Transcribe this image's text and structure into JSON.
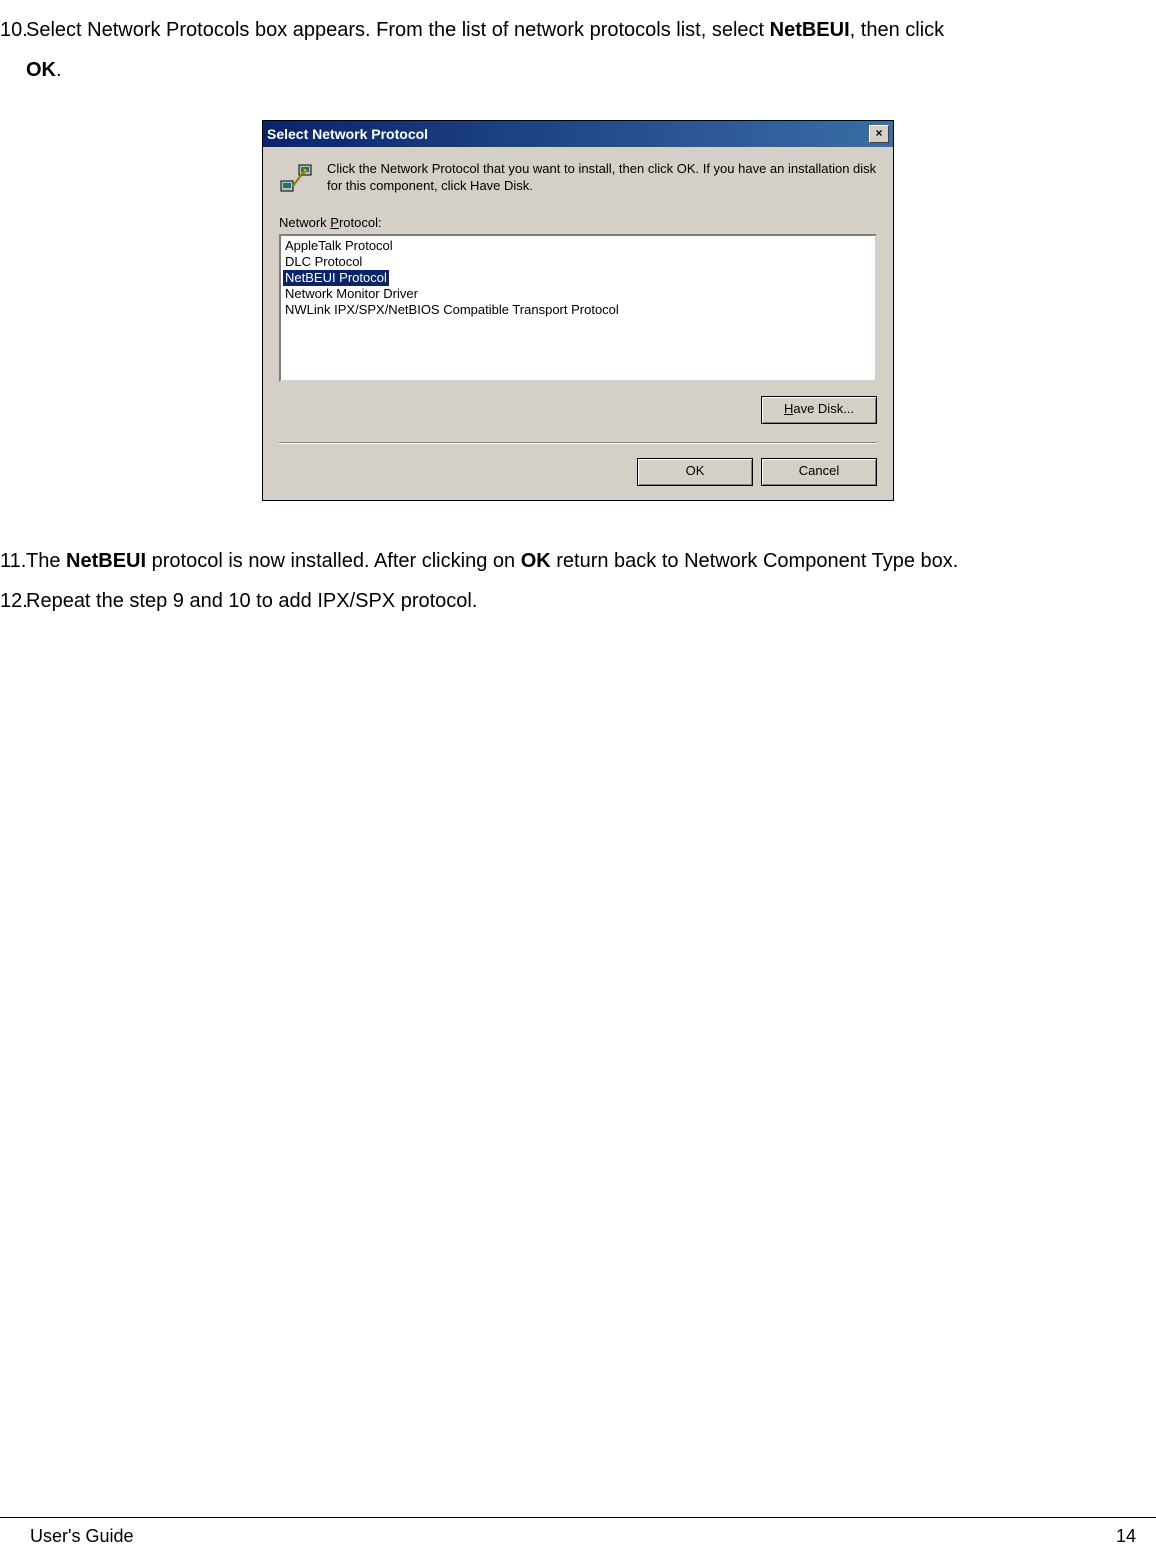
{
  "steps": {
    "s10_prefix": "10.",
    "s10_a": "Select Network Protocols box appears.  From the list of network protocols list, select ",
    "s10_bold": "NetBEUI",
    "s10_b": ", then click ",
    "s10_bold2": "OK",
    "s10_c": ".",
    "s11_prefix": "11.",
    "s11_a": "The ",
    "s11_bold": "NetBEUI",
    "s11_b": " protocol is now installed. After clicking on ",
    "s11_bold2": "OK",
    "s11_c": " return back to Network Component Type box.",
    "s12_prefix": "12.",
    "s12_a": "Repeat the step 9 and 10 to add IPX/SPX protocol."
  },
  "dialog": {
    "title": "Select Network Protocol",
    "close": "×",
    "instruction": "Click the Network Protocol that you want to install, then click OK. If you have an installation disk for this component, click Have Disk.",
    "label_pre": "Network ",
    "label_u": "P",
    "label_post": "rotocol:",
    "items": [
      "AppleTalk Protocol",
      "DLC Protocol",
      "NetBEUI Protocol",
      "Network Monitor Driver",
      "NWLink IPX/SPX/NetBIOS Compatible Transport Protocol"
    ],
    "selected_index": 2,
    "have_disk_pre": "",
    "have_disk_u": "H",
    "have_disk_post": "ave Disk...",
    "ok": "OK",
    "cancel": "Cancel"
  },
  "footer": {
    "left": "User's Guide",
    "right": "14"
  }
}
